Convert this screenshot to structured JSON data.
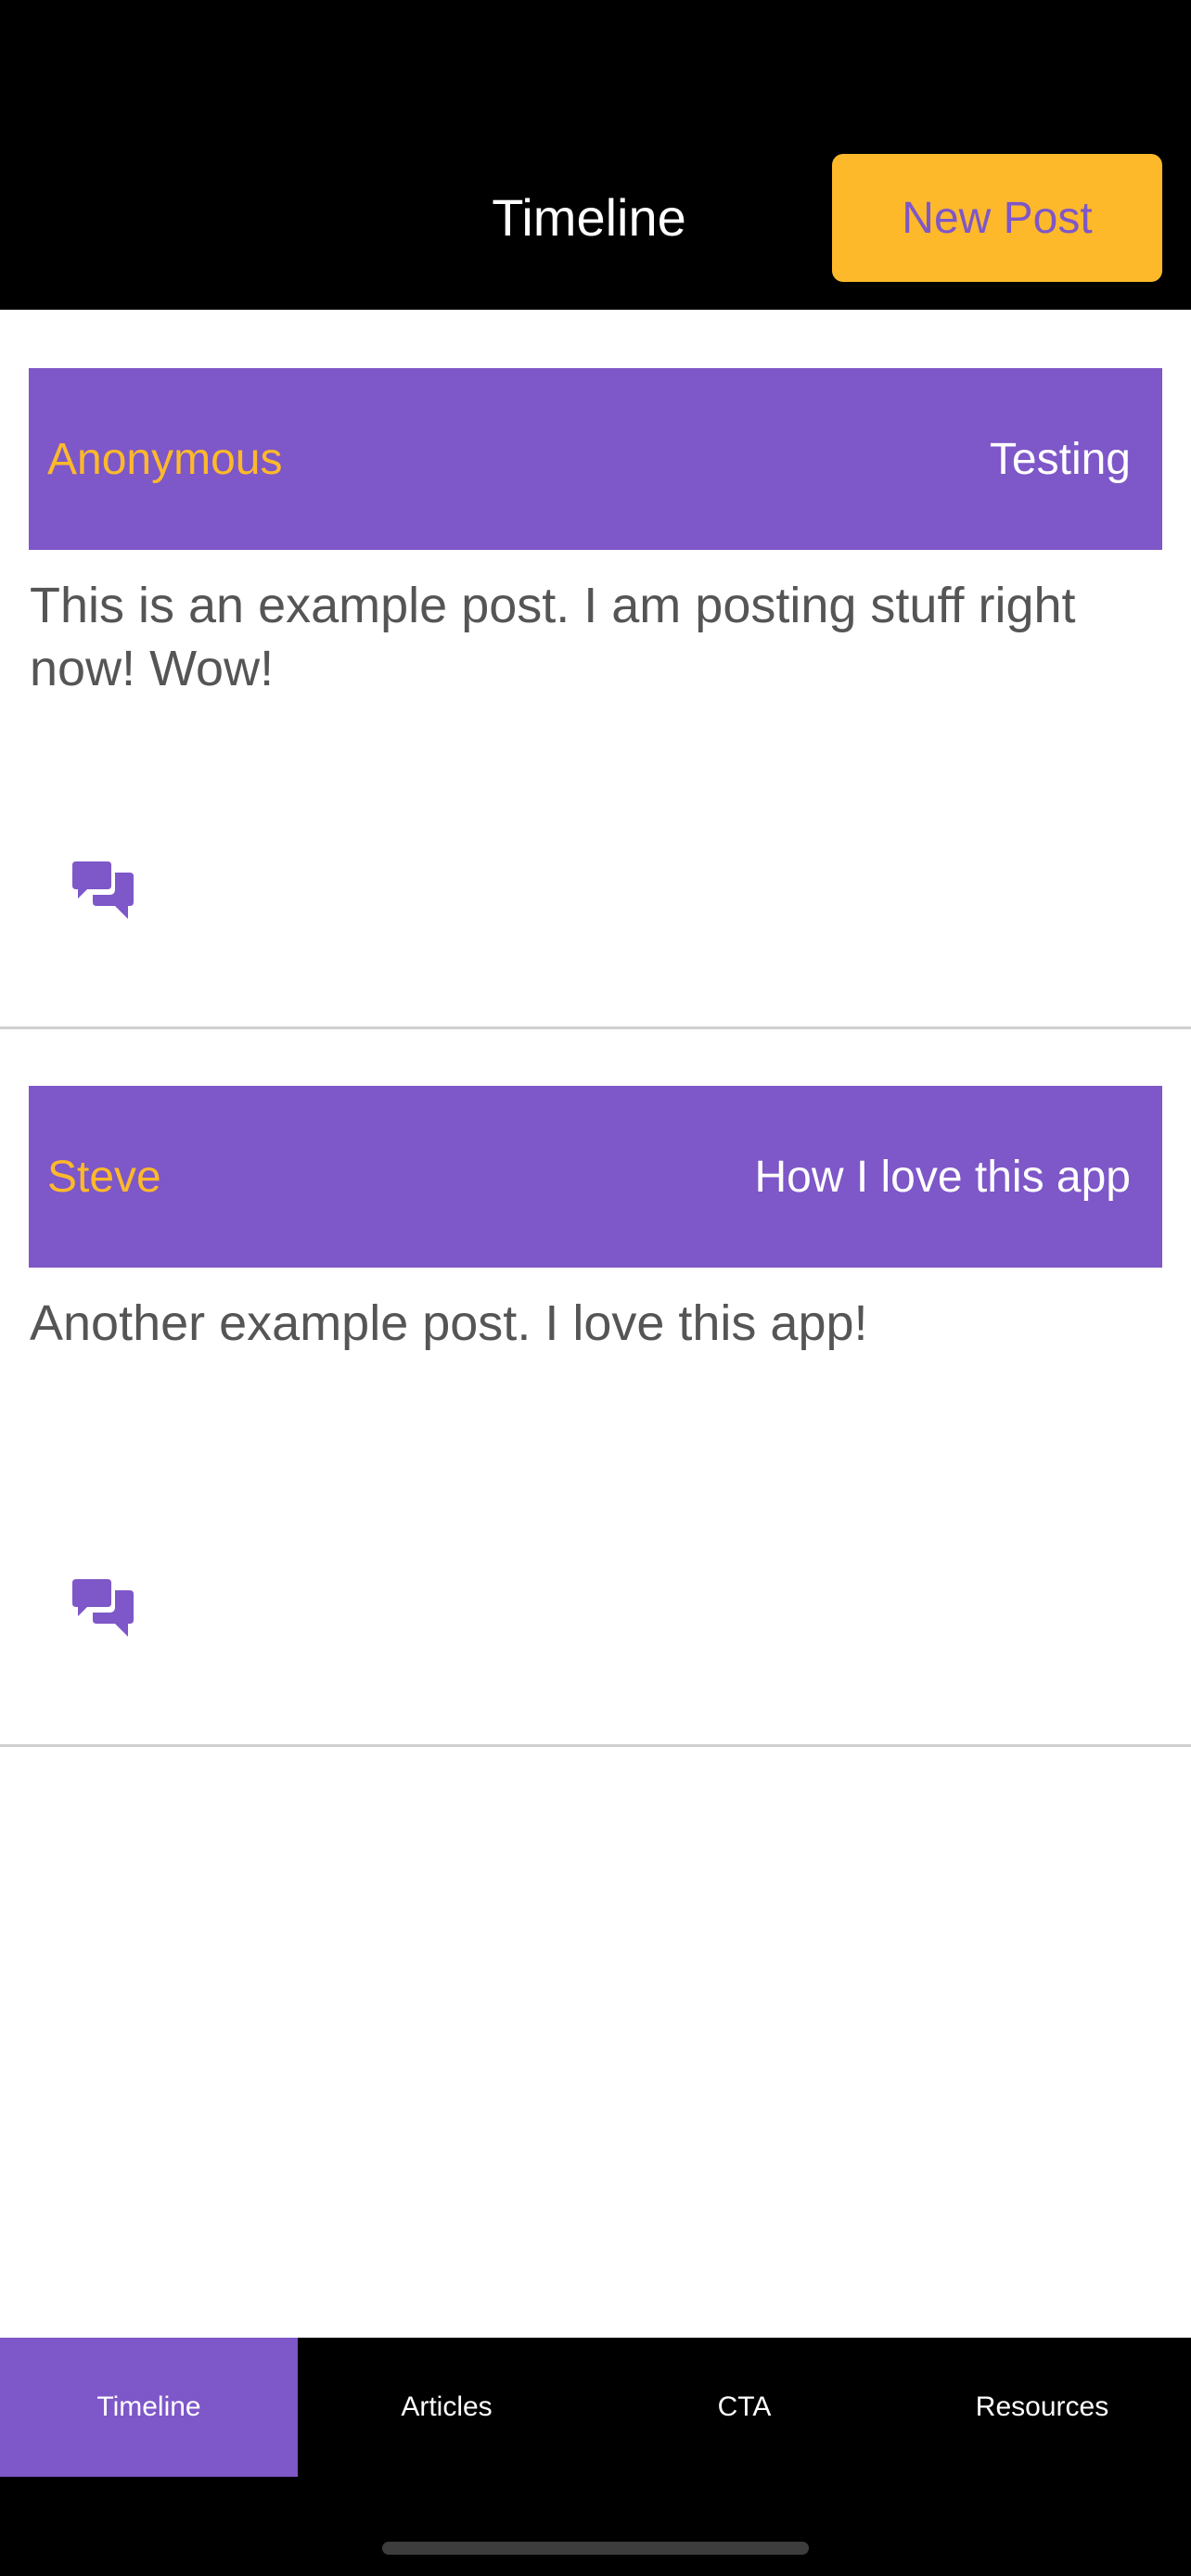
{
  "header": {
    "title": "Timeline",
    "new_post_label": "New Post"
  },
  "posts": [
    {
      "author": "Anonymous",
      "title": "Testing",
      "body": "This is an example post. I am posting stuff right now! Wow!",
      "comment_icon": "comments-icon"
    },
    {
      "author": "Steve",
      "title": "How I love this app",
      "body": "Another example post. I love this app!",
      "comment_icon": "comments-icon"
    }
  ],
  "tabs": [
    {
      "label": "Timeline",
      "active": true
    },
    {
      "label": "Articles",
      "active": false
    },
    {
      "label": "CTA",
      "active": false
    },
    {
      "label": "Resources",
      "active": false
    }
  ],
  "colors": {
    "accent_purple": "#7E57C8",
    "accent_yellow": "#FDB92A",
    "header_bg": "#000000",
    "body_text": "#555555"
  }
}
